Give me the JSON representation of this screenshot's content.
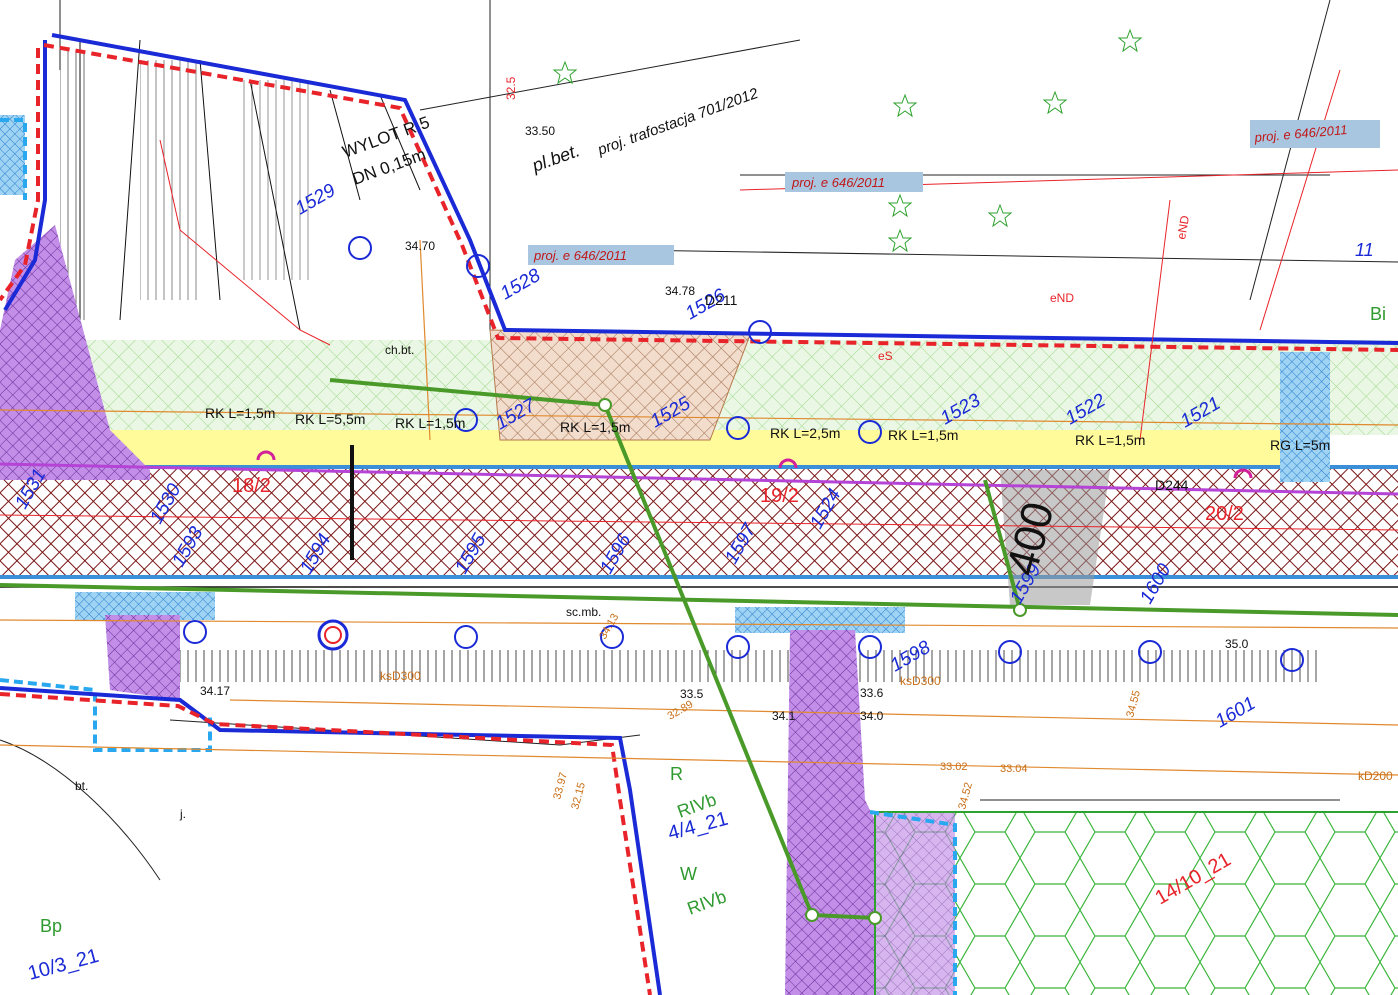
{
  "map": {
    "parcels": [
      {
        "id": "p18",
        "label": "18/2"
      },
      {
        "id": "p19",
        "label": "19/2"
      },
      {
        "id": "p20",
        "label": "20/2"
      }
    ],
    "registry_labels": [
      {
        "id": "r1",
        "label": "10/3_21"
      },
      {
        "id": "r2",
        "label": "4/4_21"
      },
      {
        "id": "r3",
        "label": "14/10_21"
      }
    ],
    "point_numbers": [
      {
        "id": "n1528",
        "label": "1528"
      },
      {
        "id": "n1529",
        "label": "1529"
      },
      {
        "id": "n1526",
        "label": "1526"
      },
      {
        "id": "n1527",
        "label": "1527"
      },
      {
        "id": "n1525",
        "label": "1525"
      },
      {
        "id": "n1524",
        "label": "1524"
      },
      {
        "id": "n1523",
        "label": "1523"
      },
      {
        "id": "n1522",
        "label": "1522"
      },
      {
        "id": "n1521",
        "label": "1521"
      },
      {
        "id": "n1530",
        "label": "1530"
      },
      {
        "id": "n1531",
        "label": "1531"
      },
      {
        "id": "n1593",
        "label": "1593"
      },
      {
        "id": "n1594",
        "label": "1594"
      },
      {
        "id": "n1595",
        "label": "1595"
      },
      {
        "id": "n1596",
        "label": "1596"
      },
      {
        "id": "n1597",
        "label": "1597"
      },
      {
        "id": "n1598",
        "label": "1598"
      },
      {
        "id": "n1599",
        "label": "1599"
      },
      {
        "id": "n1600",
        "label": "1600"
      },
      {
        "id": "n1601",
        "label": "1601"
      }
    ],
    "annotations": {
      "proj_e_1": "proj. e 646/2011",
      "proj_e_2": "proj. e 646/2011",
      "proj_e_3": "proj. e 646/2011",
      "trafostacja": "proj. trafostacja 701/2012",
      "plbet": "pl.bet.",
      "wylot": "WYLOT R 5",
      "dn": "DN 0,15m",
      "chbt": "ch.bt.",
      "bt": "bt.",
      "j": "j.",
      "scmb": "sc.mb.",
      "bp": "Bp",
      "bi": "Bi",
      "r_label": "R",
      "rivb_1": "RIVb",
      "rivb_2": "RIVb",
      "w_label": "W",
      "km_400": "400",
      "sheet_11": "11",
      "rk_1": "RK L=1,5m",
      "rk_2": "RK L=5,5m",
      "rk_3": "RK L=1,5m",
      "rk_4": "RK L=1,5m",
      "rk_5": "RK L=2,5m",
      "rk_6": "RK L=1,5m",
      "rk_7": "RK L=1,5m",
      "rg": "RG L=5m",
      "ks300_1": "ksD300",
      "ks300_2": "ksD300",
      "kd200": "kD200",
      "d211": "D211",
      "d244": "D244",
      "elev_3350": "33.50",
      "elev_3470": "34.70",
      "elev_3478": "34.78",
      "elev_3350b": "33.5",
      "elev_3410": "34.1",
      "elev_3400": "34.0",
      "elev_3560": "33.6",
      "elev_3500": "35.0",
      "elev_3302": "33.02",
      "elev_3304": "33.04",
      "elev_3452": "34.52",
      "elev_3455": "34.55",
      "elev_3397": "33.97",
      "elev_3215": "32.15",
      "elev_3289": "32.89",
      "elev_3417": "34.17",
      "elev_3413": "34.13",
      "elev_325": "32.5",
      "ens_1": "eND",
      "ens_2": "eND",
      "ens_3": "eS"
    }
  }
}
